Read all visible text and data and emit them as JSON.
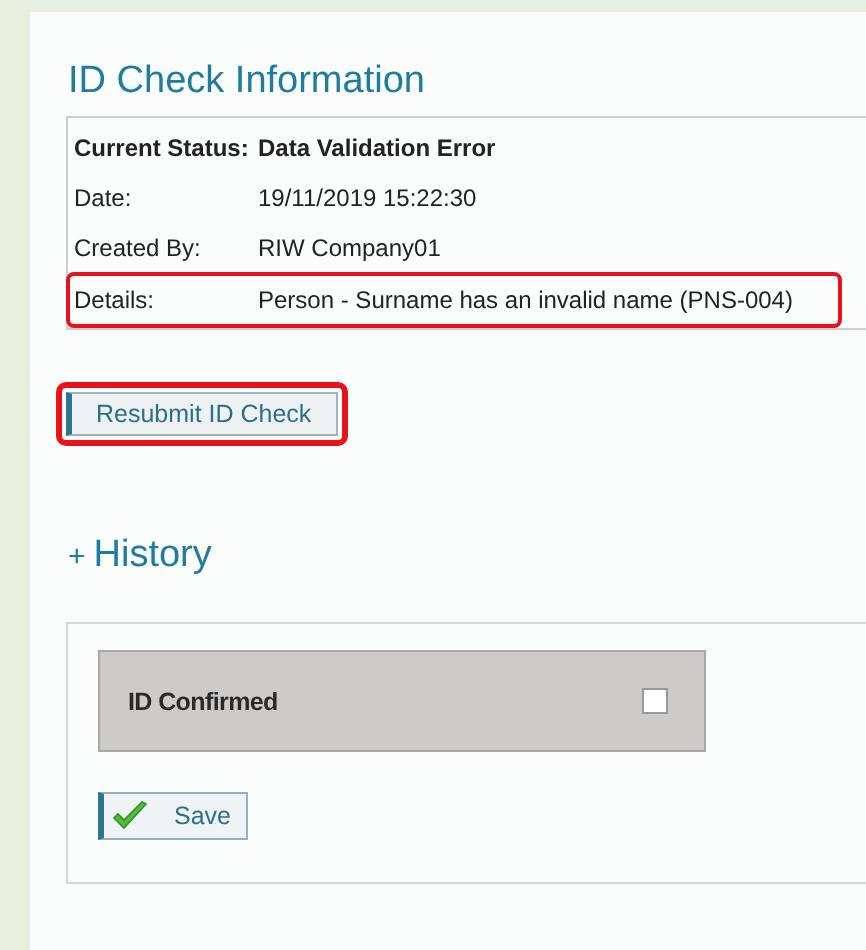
{
  "title": "ID Check Information",
  "details": [
    {
      "label": "Current Status:",
      "value": "Data Validation Error",
      "bold": true,
      "highlighted": false
    },
    {
      "label": "Date:",
      "value": "19/11/2019 15:22:30",
      "bold": false,
      "highlighted": false
    },
    {
      "label": "Created By:",
      "value": "RIW Company01",
      "bold": false,
      "highlighted": false
    },
    {
      "label": "Details:",
      "value": "Person - Surname has an invalid name (PNS-004)",
      "bold": false,
      "highlighted": true
    }
  ],
  "resubmit_button": {
    "label": "Resubmit ID Check",
    "highlighted": true
  },
  "history": {
    "toggle": "+",
    "title": "History"
  },
  "form": {
    "fields": [
      {
        "kind": "checkbox",
        "label": "ID Confirmed",
        "checked": false
      }
    ],
    "save_button": {
      "label": "Save"
    }
  }
}
